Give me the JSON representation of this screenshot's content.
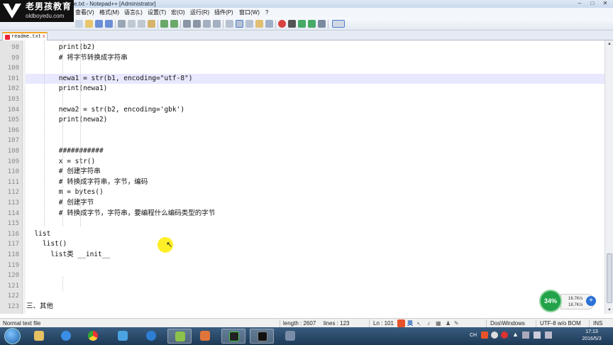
{
  "window": {
    "title": "e.txt - Notepad++ [Administrator]",
    "controls": [
      "–",
      "□",
      "✕"
    ]
  },
  "logo": {
    "name": "老男孩教育",
    "url": "oldboyedu.com"
  },
  "menu": {
    "items": [
      "查看(V)",
      "格式(M)",
      "语言(L)",
      "设置(T)",
      "宏(O)",
      "运行(R)",
      "插件(P)",
      "窗口(W)",
      "?"
    ]
  },
  "tab": {
    "label": "readme.txt",
    "close": "x"
  },
  "editor": {
    "lines": [
      {
        "n": "98",
        "text": "        print(b2)"
      },
      {
        "n": "99",
        "text": "        # 将字节转换成字符串"
      },
      {
        "n": "100",
        "text": ""
      },
      {
        "n": "101",
        "text": "        newa1 = str(b1, encoding=\"utf-8\")"
      },
      {
        "n": "102",
        "text": "        print(newa1)"
      },
      {
        "n": "103",
        "text": ""
      },
      {
        "n": "104",
        "text": "        newa2 = str(b2, encoding='gbk')"
      },
      {
        "n": "105",
        "text": "        print(newa2)"
      },
      {
        "n": "106",
        "text": ""
      },
      {
        "n": "107",
        "text": ""
      },
      {
        "n": "108",
        "text": "        ###########"
      },
      {
        "n": "109",
        "text": "        x = str()"
      },
      {
        "n": "110",
        "text": "        # 创建字符串"
      },
      {
        "n": "111",
        "text": "        # 转换成字符串，字节，编码"
      },
      {
        "n": "112",
        "text": "        m = bytes()"
      },
      {
        "n": "113",
        "text": "        # 创建字节"
      },
      {
        "n": "114",
        "text": "        # 转换成字节，字符串，要编程什么编码类型的字节"
      },
      {
        "n": "115",
        "text": ""
      },
      {
        "n": "116",
        "text": "  list"
      },
      {
        "n": "117",
        "text": "    list()"
      },
      {
        "n": "118",
        "text": "      list类 __init__"
      },
      {
        "n": "119",
        "text": ""
      },
      {
        "n": "120",
        "text": ""
      },
      {
        "n": "121",
        "text": ""
      },
      {
        "n": "122",
        "text": ""
      },
      {
        "n": "123",
        "text": "三、其他"
      }
    ]
  },
  "net_widget": {
    "percent": "34%",
    "up": "16.7K/s",
    "down": "18.7K/s",
    "plus": "+"
  },
  "status": {
    "file_type": "Normal text file",
    "length": "length : 2607",
    "lines": "lines : 123",
    "ln": "Ln : 101",
    "ime": "英",
    "eol": "Dos\\Windows",
    "encoding": "UTF-8 w/o BOM",
    "mode": "INS"
  },
  "tray": {
    "lang": "CH",
    "time": "17:13",
    "date": "2016/5/3"
  },
  "colors": {
    "title_bar": "#c9d9ee",
    "gutter": "#e4e4e4",
    "current_line": "#e8e8ff",
    "taskbar": "#1d3957",
    "net_green": "#22a34a"
  }
}
